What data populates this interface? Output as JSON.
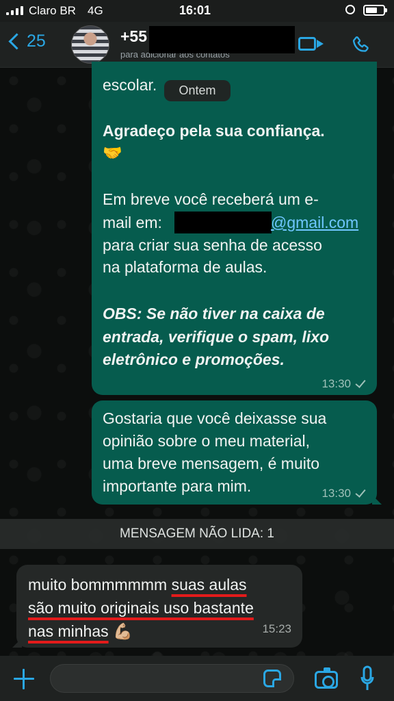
{
  "status_bar": {
    "carrier": "Claro BR",
    "network": "4G",
    "time": "16:01"
  },
  "header": {
    "back_count": "25",
    "contact_name": "+55",
    "contact_subtitle": "para adicionar aos contatos"
  },
  "date_chip": "Ontem",
  "messages": {
    "m1": {
      "line_top": "escolar.",
      "bold_line": "Agradeço pela sua confiança.",
      "emoji": "🤝",
      "line3": "Em breve você receberá um e-",
      "line4_prefix": "mail em:",
      "email_domain": "@gmail.com",
      "line5": "para criar sua senha de acesso",
      "line6": "na plataforma de aulas.",
      "obs1": "OBS: Se não tiver na caixa de",
      "obs2": "entrada, verifique o spam, lixo",
      "obs3": "eletrônico e promoções.",
      "time": "13:30"
    },
    "m2": {
      "line1": "Gostaria que você deixasse sua",
      "line2": "opinião sobre o meu material,",
      "line3": "uma breve mensagem, é muito",
      "line4": "importante para mim.",
      "time": "13:30"
    },
    "m3": {
      "line1_plain": "muito bommmmmm ",
      "line1_underlined": "suas aulas",
      "line2": "são muito originais uso bastante",
      "line3": "nas minhas",
      "emoji": "💪🏼",
      "time": "15:23"
    }
  },
  "unread_banner": "MENSAGEM NÃO LIDA: 1",
  "colors": {
    "accent": "#2aa7e4",
    "outgoing_bubble": "#065c4e",
    "incoming_bubble": "#252827",
    "highlight_underline": "#e31b1b"
  },
  "icons": [
    "back-chevron-icon",
    "video-call-icon",
    "phone-icon",
    "plus-icon",
    "sticker-icon",
    "camera-icon",
    "mic-icon"
  ]
}
